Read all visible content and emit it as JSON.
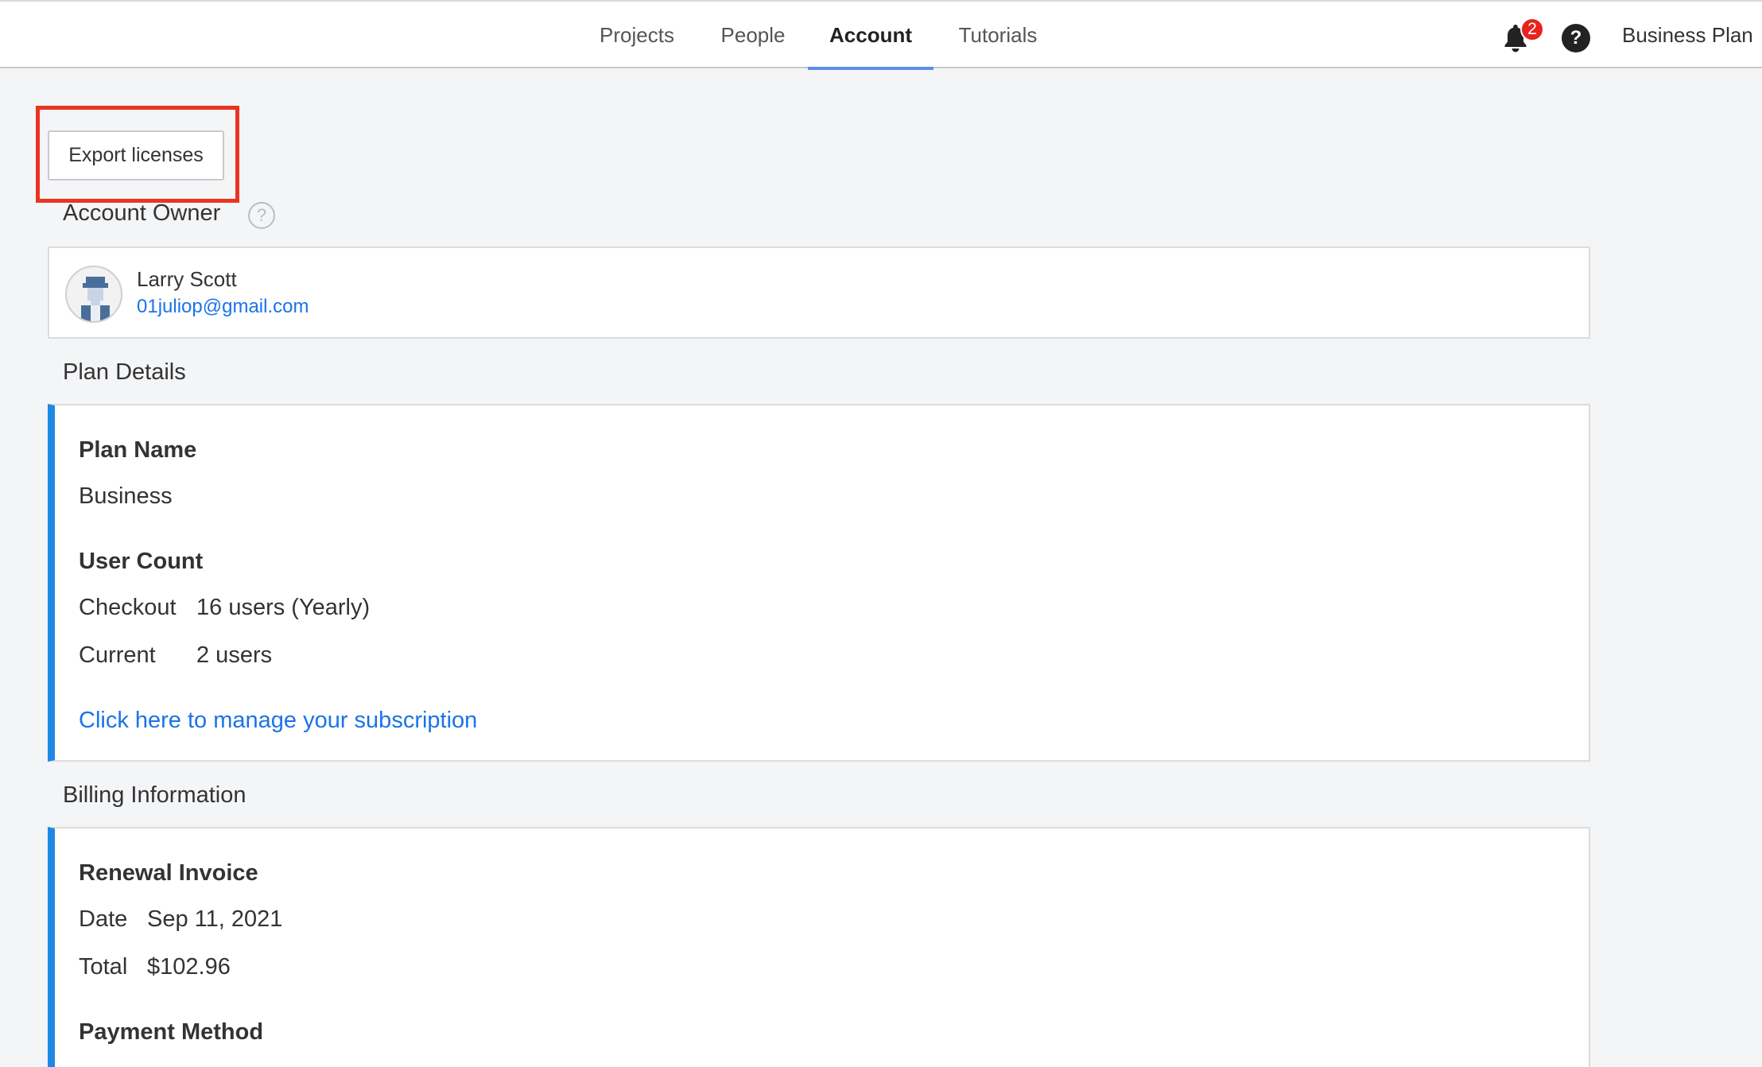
{
  "nav": {
    "tabs": [
      {
        "label": "Projects"
      },
      {
        "label": "People"
      },
      {
        "label": "Account"
      },
      {
        "label": "Tutorials"
      }
    ],
    "notifications_count": "2",
    "help_glyph": "?",
    "plan_label": "Business Plan",
    "accent_color": "#5b8def"
  },
  "export_button_label": "Export licenses",
  "account_owner": {
    "title": "Account Owner",
    "help_glyph": "?",
    "name": "Larry Scott",
    "email": "01juliop@gmail.com"
  },
  "plan_details": {
    "title": "Plan Details",
    "plan_name_label": "Plan Name",
    "plan_name_value": "Business",
    "user_count_label": "User Count",
    "checkout_label": "Checkout",
    "checkout_value": "16 users (Yearly)",
    "current_label": "Current",
    "current_value": "2 users",
    "manage_link": "Click here to manage your subscription"
  },
  "billing": {
    "title": "Billing Information",
    "renewal_label": "Renewal Invoice",
    "date_label": "Date",
    "date_value": "Sep 11, 2021",
    "total_label": "Total",
    "total_value": "$102.96",
    "payment_label": "Payment Method"
  },
  "colors": {
    "highlight": "#ea3323",
    "card_accent": "#1e88e5",
    "link": "#1a73e8",
    "badge": "#e8231e"
  }
}
